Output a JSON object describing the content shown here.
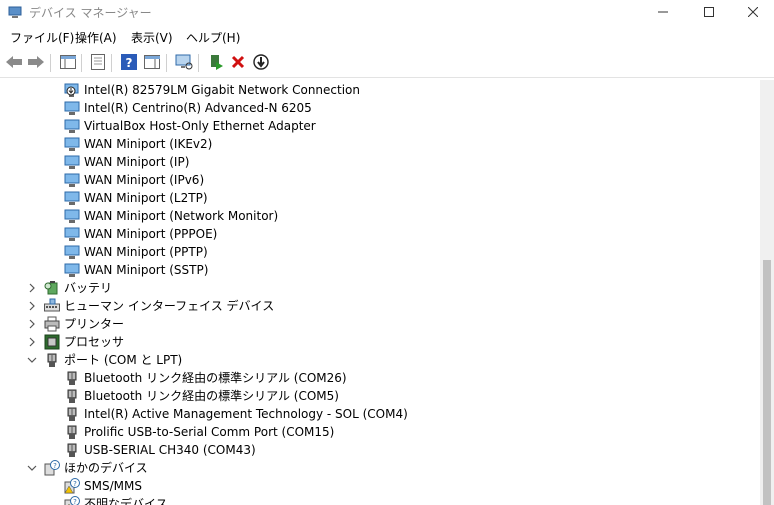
{
  "window": {
    "title": "デバイス マネージャー"
  },
  "menubar": {
    "items": [
      {
        "label": "ファイル(F)"
      },
      {
        "label": "操作(A)"
      },
      {
        "label": "表示(V)"
      },
      {
        "label": "ヘルプ(H)"
      }
    ]
  },
  "toolbar": {
    "buttons": [
      "back-arrow-icon",
      "forward-arrow-icon",
      "show-hide-tree-icon",
      "properties-icon",
      "help-icon",
      "action-pane-icon",
      "scan-hardware-icon",
      "update-driver-icon",
      "uninstall-device-icon",
      "disable-device-icon"
    ]
  },
  "tree": {
    "network_adapters": [
      "Intel(R) 82579LM Gigabit Network Connection",
      "Intel(R) Centrino(R) Advanced-N 6205",
      "VirtualBox Host-Only Ethernet Adapter",
      "WAN Miniport (IKEv2)",
      "WAN Miniport (IP)",
      "WAN Miniport (IPv6)",
      "WAN Miniport (L2TP)",
      "WAN Miniport (Network Monitor)",
      "WAN Miniport (PPPOE)",
      "WAN Miniport (PPTP)",
      "WAN Miniport (SSTP)"
    ],
    "categories": {
      "battery": "バッテリ",
      "hid": "ヒューマン インターフェイス デバイス",
      "printer": "プリンター",
      "processor": "プロセッサ",
      "ports": "ポート (COM と LPT)",
      "other": "ほかのデバイス"
    },
    "ports": [
      "Bluetooth リンク経由の標準シリアル (COM26)",
      "Bluetooth リンク経由の標準シリアル (COM5)",
      "Intel(R) Active Management Technology - SOL (COM4)",
      "Prolific USB-to-Serial Comm Port (COM15)",
      "USB-SERIAL CH340 (COM43)"
    ],
    "other_devices": [
      "SMS/MMS",
      "不明なデバイス"
    ]
  }
}
